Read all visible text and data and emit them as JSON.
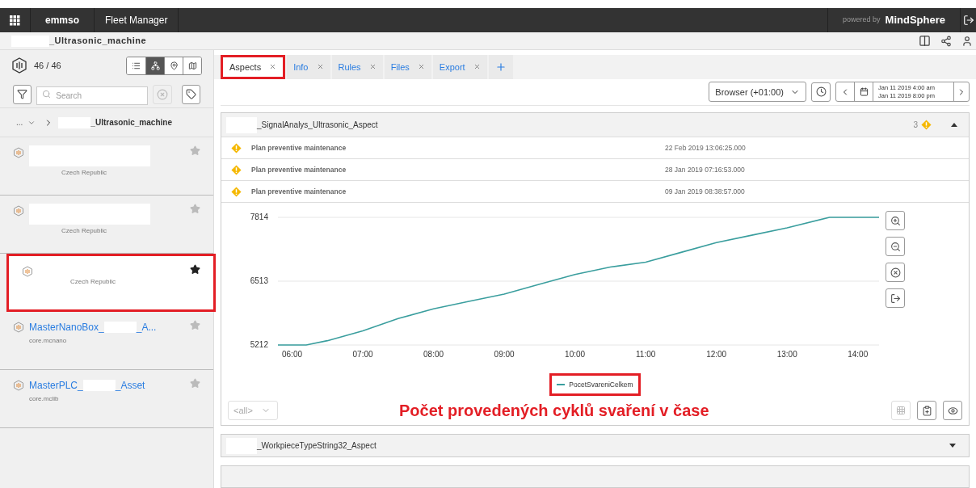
{
  "header": {
    "tenant": "emmso",
    "app": "Fleet Manager",
    "powered_by": "powered by",
    "brand": "MindSphere"
  },
  "breadcrumb": "_Ultrasonic_machine",
  "sidebar": {
    "count": "46 / 46",
    "view_modes": [
      {
        "kind": "list",
        "selected": false
      },
      {
        "kind": "tree",
        "selected": true
      },
      {
        "kind": "pin",
        "selected": false
      },
      {
        "kind": "map",
        "selected": false
      }
    ],
    "search": {
      "placeholder": "Search"
    },
    "tree_prefix": "...",
    "tree_root": "_Ultrasonic_machine",
    "assets": [
      {
        "subtitle": "Czech Republic",
        "favorite": false,
        "selected": false
      },
      {
        "subtitle": "Czech Republic",
        "favorite": false,
        "selected": false
      },
      {
        "subtitle": "Czech Republic",
        "favorite": true,
        "selected": true
      },
      {
        "name": "MasterNanoBox_",
        "name_end": "_A...",
        "subtitle": "core.mcnano",
        "favorite": false,
        "selected": false
      },
      {
        "name": "MasterPLC_",
        "name_end": "_Asset",
        "subtitle": "core.mclib",
        "favorite": false,
        "selected": false
      }
    ]
  },
  "tabs": [
    {
      "label": "Aspects",
      "selected": true
    },
    {
      "label": "Info",
      "selected": false
    },
    {
      "label": "Rules",
      "selected": false
    },
    {
      "label": "Files",
      "selected": false
    },
    {
      "label": "Export",
      "selected": false
    }
  ],
  "timezone": "Browser (+01:00)",
  "range_start": "Jan 11 2019 4:00 am",
  "range_end": "Jan 11 2019 8:00 pm",
  "aspect": {
    "title": "_SignalAnalys_Ultrasonic_Aspect",
    "alert_count": "3",
    "expanded": true,
    "events": [
      {
        "text": "Plan preventive maintenance",
        "time": "22 Feb 2019 13:06:25.000"
      },
      {
        "text": "Plan preventive maintenance",
        "time": "28 Jan 2019 07:16:53.000"
      },
      {
        "text": "Plan preventive maintenance",
        "time": "09 Jan 2019 08:38:57.000"
      }
    ],
    "chart_data": {
      "type": "line",
      "x": [
        5.8,
        6.2,
        6.5,
        7.0,
        7.5,
        8.0,
        8.5,
        9.0,
        9.5,
        10.0,
        10.5,
        11.0,
        11.5,
        12.0,
        12.5,
        13.0,
        13.6,
        14.3
      ],
      "series": [
        {
          "name": "PocetSvareniCelkem",
          "color": "#3a9e9e",
          "values": [
            5212,
            5212,
            5300,
            5500,
            5750,
            5950,
            6100,
            6250,
            6450,
            6650,
            6800,
            6900,
            7100,
            7300,
            7450,
            7600,
            7814,
            7814
          ]
        }
      ],
      "xlim": [
        5.8,
        14.3
      ],
      "ylim": [
        5212,
        7814
      ],
      "xticks": [
        {
          "value": 6,
          "label": "06:00"
        },
        {
          "value": 7,
          "label": "07:00"
        },
        {
          "value": 8,
          "label": "08:00"
        },
        {
          "value": 9,
          "label": "09:00"
        },
        {
          "value": 10,
          "label": "10:00"
        },
        {
          "value": 11,
          "label": "11:00"
        },
        {
          "value": 12,
          "label": "12:00"
        },
        {
          "value": 13,
          "label": "13:00"
        },
        {
          "value": 14,
          "label": "14:00"
        }
      ],
      "yticks": [
        5212,
        6513,
        7814
      ]
    },
    "filter": "<all>",
    "caption": "Počet provedených cyklů svaření v čase"
  },
  "aspect2": {
    "title": "_WorkpieceTypeString32_Aspect",
    "expanded": false
  }
}
